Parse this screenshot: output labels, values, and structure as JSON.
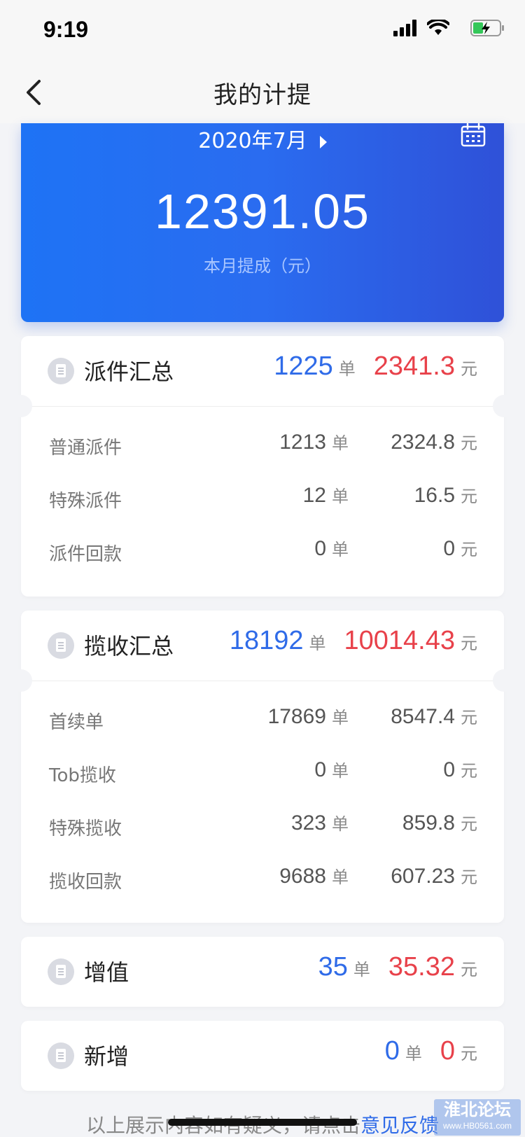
{
  "status_bar": {
    "time": "9:19"
  },
  "nav": {
    "title": "我的计提"
  },
  "hero": {
    "month": "2020年7月",
    "amount": "12391.05",
    "subtitle": "本月提成（元）"
  },
  "cards": {
    "dispatch": {
      "title": "派件汇总",
      "count": "1225",
      "amount": "2341.3",
      "rows": [
        {
          "label": "普通派件",
          "count": "1213",
          "amount": "2324.8"
        },
        {
          "label": "特殊派件",
          "count": "12",
          "amount": "16.5"
        },
        {
          "label": "派件回款",
          "count": "0",
          "amount": "0"
        }
      ]
    },
    "pickup": {
      "title": "揽收汇总",
      "count": "18192",
      "amount": "10014.43",
      "rows": [
        {
          "label": "首续单",
          "count": "17869",
          "amount": "8547.4"
        },
        {
          "label": "Tob揽收",
          "count": "0",
          "amount": "0"
        },
        {
          "label": "特殊揽收",
          "count": "323",
          "amount": "859.8"
        },
        {
          "label": "揽收回款",
          "count": "9688",
          "amount": "607.23"
        }
      ]
    },
    "value_added": {
      "title": "增值",
      "count": "35",
      "amount": "35.32"
    },
    "new_added": {
      "title": "新增",
      "count": "0",
      "amount": "0"
    }
  },
  "units": {
    "order": "单",
    "yuan": "元"
  },
  "footer": {
    "text": "以上展示内容如有疑义，请点击",
    "link": "意见反馈"
  },
  "watermark": {
    "top": "淮北论坛",
    "bottom": "www.HB0561.com"
  },
  "colors": {
    "blue": "#2f6be8",
    "red": "#e8414a",
    "hero_start": "#1e73f5",
    "hero_end": "#2f51d8"
  }
}
